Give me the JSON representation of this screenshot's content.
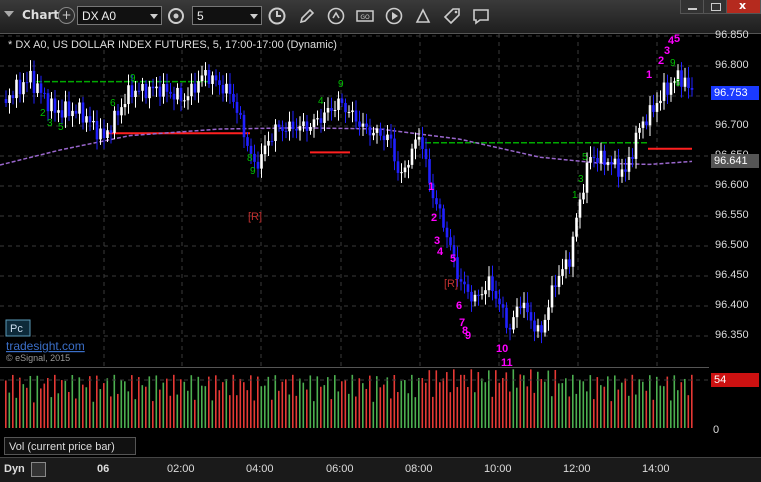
{
  "toolbar": {
    "chart_label": "Chart",
    "symbol_value": "DX A0",
    "interval_value": "5"
  },
  "chart": {
    "title": "* DX A0, US DOLLAR INDEX FUTURES, 5, 17:00-17:00 (Dynamic)",
    "pc_badge": "Pc",
    "watermark": "tradesight.com",
    "copyright": "© eSignal, 2015",
    "price_ticks": [
      "96.850",
      "96.800",
      "96.750",
      "96.700",
      "96.650",
      "96.600",
      "96.550",
      "96.500",
      "96.450",
      "96.400",
      "96.350"
    ],
    "last_price": "96.753",
    "ma_price": "96.641",
    "r_marker_1": "[R]",
    "r_marker_2": "[R]",
    "down_count": [
      "1",
      "2",
      "3",
      "4",
      "5",
      "6",
      "7",
      "8",
      "9",
      "10",
      "11"
    ],
    "up_count": [
      "1",
      "2",
      "3",
      "4",
      "5"
    ]
  },
  "volume": {
    "label": "Vol (current price bar)",
    "last_value": "54",
    "zero_label": "0"
  },
  "xaxis": {
    "dyn_label": "Dyn",
    "ticks": [
      "06",
      "02:00",
      "04:00",
      "06:00",
      "08:00",
      "10:00",
      "12:00",
      "14:00"
    ]
  },
  "colors": {
    "up_bar": "#ffffff",
    "down_bar": "#2020ff",
    "ma_line": "#9966cc",
    "resistance": "#00aa00",
    "support": "#ff2020",
    "td_down": "#ff00ff",
    "td_up": "#00c000",
    "last_price_tag": "#1a3aff",
    "vol_up": "#4caf50",
    "vol_down": "#e53935"
  }
}
